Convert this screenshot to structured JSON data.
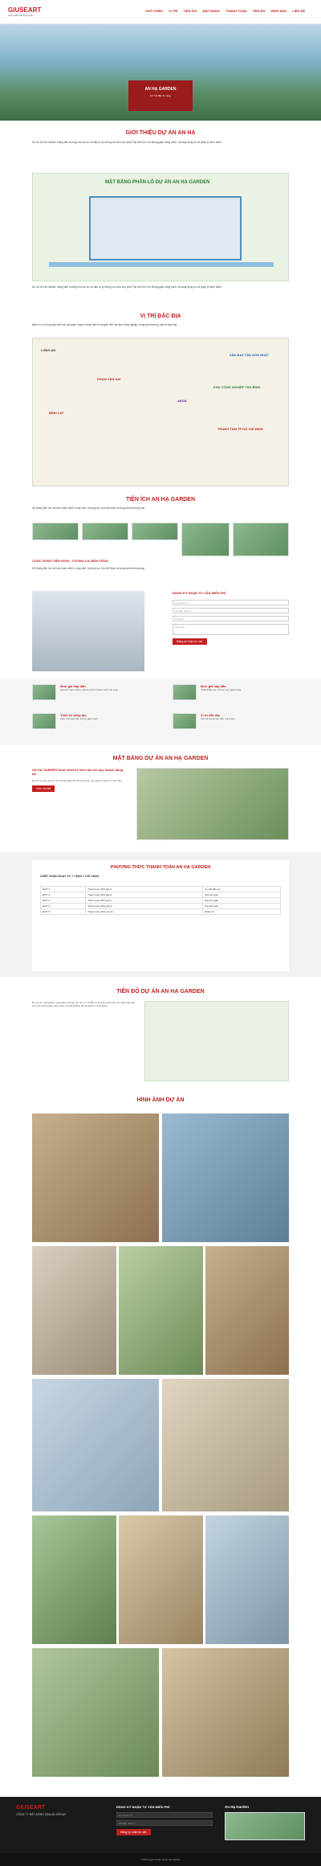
{
  "header": {
    "logo": "GIUSEART",
    "logo_sub": "Giải pháp bất động sản",
    "nav": [
      "GIỚI THIỆU",
      "VỊ TRÍ",
      "TIỆN ÍCH",
      "MẶT BẰNG",
      "THANH TOÁN",
      "TIẾN ĐỘ",
      "HÌNH ẢNH",
      "LIÊN HỆ"
    ]
  },
  "hero": {
    "title": "AN HẠ GARDEN",
    "subtitle": "Cơ hội đầu tư vàng"
  },
  "intro": {
    "title": "GIỚI THIỆU DỰ ÁN AN HẠ",
    "text": "Dự án An Hạ Garden mang đến hướng nhìn an cư và đầu tư lý tưởng cho khu vực phía Tây Sài Gòn với không gian sống xanh, hạ tầng đồng bộ và pháp lý minh bạch."
  },
  "plan_map": {
    "title": "MẶT BẰNG PHÂN LÔ DỰ ÁN AN HẠ GARDEN"
  },
  "location": {
    "title": "VỊ TRÍ ĐẮC ĐỊA",
    "text": "Nằm ở vị trí trung tâm kết nối các quận huyện, thuận tiện di chuyển đến các khu công nghiệp, trung tâm thương mại và sân bay.",
    "labels": [
      "LONG AN",
      "SÂN BAY TÂN SƠN NHẤT",
      "KHU CÔNG NGHIỆP TÂN BÌNH",
      "PHẠM VĂN HAI",
      "BÌNH LỢI",
      "AEON",
      "TRUNG TÂM TP HỒ CHÍ MINH"
    ]
  },
  "amenities": {
    "title": "TIỆN ÍCH AN HẠ GARDEN",
    "highlight": "CUỘC SỐNG TIỆN NGHI - TƯƠNG LAI BỀN VỮNG",
    "text": "Hệ thống tiện ích nội khu hoàn chỉnh: công viên, trường học, khu thể thao và trung tâm thương mại."
  },
  "form": {
    "title": "ĐĂNG KÝ NHẬN TƯ VẤN MIỄN PHÍ",
    "fields": [
      "Họ và tên (*)",
      "Số điện thoại (*)",
      "Email (*)",
      "Nội dung"
    ],
    "button": "Đăng ký nhận tư vấn"
  },
  "features": [
    {
      "title": "Mức giá hấp dẫn",
      "text": "Giá bán cạnh tranh, phương thức thanh toán linh hoạt."
    },
    {
      "title": "Mức giá hấp dẫn",
      "text": "Chiết khấu cao, hỗ trợ vay ngân hàng."
    },
    {
      "title": "Thiết kế sáng tạo",
      "text": "Kiến trúc hiện đại, không gian xanh."
    },
    {
      "title": "Vị trí đắc địa",
      "text": "Kết nối thuận tiện đến trung tâm."
    }
  ],
  "masterplan": {
    "title": "MẶT BẰNG DỰ ÁN AN HẠ GARDEN",
    "lead": "AN HẠ GARDEN được thiết kế hiện đại với quy hoạch đồng bộ.",
    "text": "Dự án có quy mô lớn với hạ tầng đầy đủ, đường rộng, cây xanh và tiện ích hiện đại.",
    "button": "Xem chi tiết"
  },
  "payment": {
    "title": "PHƯƠNG THỨC THANH TOÁN AN HẠ GARDEN",
    "subtitle": "CHIẾT KHẤU NGAY 3% + TẶNG 1 CHỈ VÀNG",
    "rows": [
      [
        "ĐỢT 1",
        "Thanh toán 30% giá trị",
        "Ký HĐ đặt cọc"
      ],
      [
        "ĐỢT 2",
        "Thanh toán 20% giá trị",
        "Sau 30 ngày"
      ],
      [
        "ĐỢT 3",
        "Thanh toán 20% giá trị",
        "Sau 60 ngày"
      ],
      [
        "ĐỢT 4",
        "Thanh toán 20% giá trị",
        "Sau 90 ngày"
      ],
      [
        "ĐỢT 5",
        "Thanh toán 10% còn lại",
        "Nhận sổ"
      ]
    ]
  },
  "progress": {
    "title": "TIẾN ĐỘ DỰ ÁN AN HẠ GARDEN"
  },
  "gallery": {
    "title": "HÌNH ẢNH DỰ ÁN"
  },
  "footer": {
    "company": "GIUSEART",
    "company_sub": "CÔNG TY BẤT ĐỘNG SẢN AN GROUP",
    "form_title": "ĐĂNG KÝ NHẬN TƯ VẤN MIỄN PHÍ",
    "project": "An Hạ Garden",
    "copyright": "© Bản quyền thuộc về An Hạ Garden"
  }
}
